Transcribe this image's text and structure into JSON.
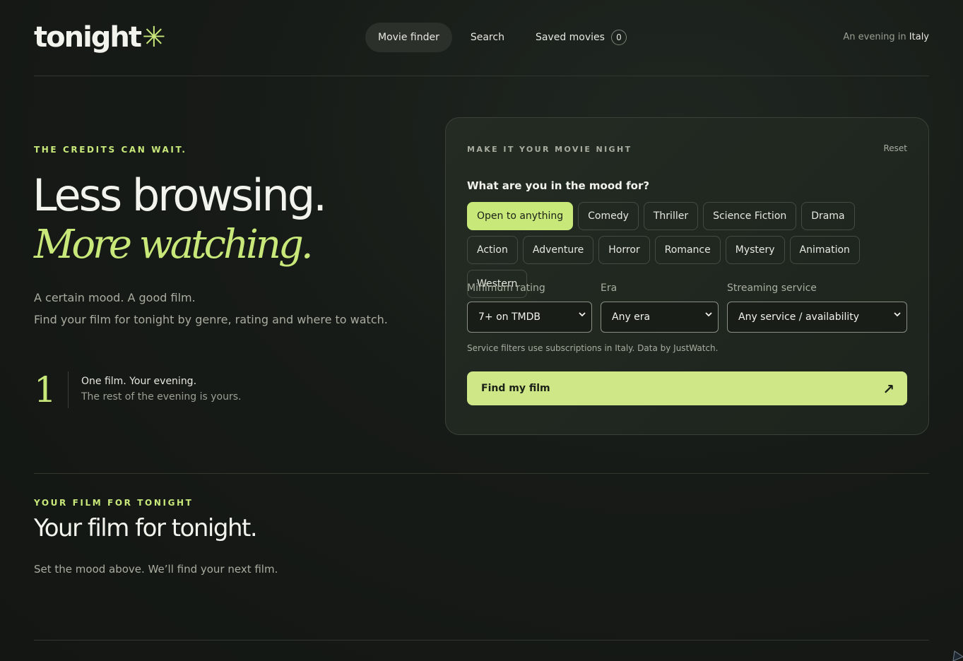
{
  "header": {
    "logo_text": "tonight",
    "logo_mark": "✳",
    "nav": [
      {
        "label": "Movie finder",
        "active": true
      },
      {
        "label": "Search",
        "active": false
      },
      {
        "label": "Saved movies",
        "active": false,
        "count": "0"
      }
    ],
    "locale_prefix": "An evening in",
    "locale_country": "Italy"
  },
  "hero": {
    "eyebrow": "THE CREDITS CAN WAIT.",
    "title_line1": "Less browsing.",
    "title_line2": "More watching.",
    "sub_line1": "A certain mood. A good film.",
    "sub_line2": "Find your film for tonight by genre, rating and where to watch.",
    "stat_number": "1",
    "stat_title": "One film. Your evening.",
    "stat_sub": "The rest of the evening is yours."
  },
  "finder": {
    "eyebrow": "MAKE IT YOUR MOVIE NIGHT",
    "reset_label": "Reset",
    "mood_question": "What are you in the mood for?",
    "genres": [
      {
        "label": "Open to anything",
        "selected": true
      },
      {
        "label": "Comedy",
        "selected": false
      },
      {
        "label": "Thriller",
        "selected": false
      },
      {
        "label": "Science Fiction",
        "selected": false
      },
      {
        "label": "Drama",
        "selected": false
      },
      {
        "label": "Action",
        "selected": false
      },
      {
        "label": "Adventure",
        "selected": false
      },
      {
        "label": "Horror",
        "selected": false
      },
      {
        "label": "Romance",
        "selected": false
      },
      {
        "label": "Mystery",
        "selected": false
      },
      {
        "label": "Animation",
        "selected": false
      },
      {
        "label": "Western",
        "selected": false
      }
    ],
    "rating_label": "Minimum rating",
    "rating_value": "7+ on TMDB",
    "era_label": "Era",
    "era_value": "Any era",
    "service_label": "Streaming service",
    "service_value": "Any service / availability",
    "note": "Service filters use subscriptions in Italy. Data by JustWatch.",
    "cta_label": "Find my film",
    "cta_icon": "arrow-up-right-icon"
  },
  "result": {
    "eyebrow": "YOUR FILM FOR TONIGHT",
    "title": "Your film for tonight.",
    "sub": "Set the mood above. We’ll find your next film."
  },
  "colors": {
    "accent": "#c8e87a",
    "background": "#161a16",
    "card": "#202720"
  }
}
